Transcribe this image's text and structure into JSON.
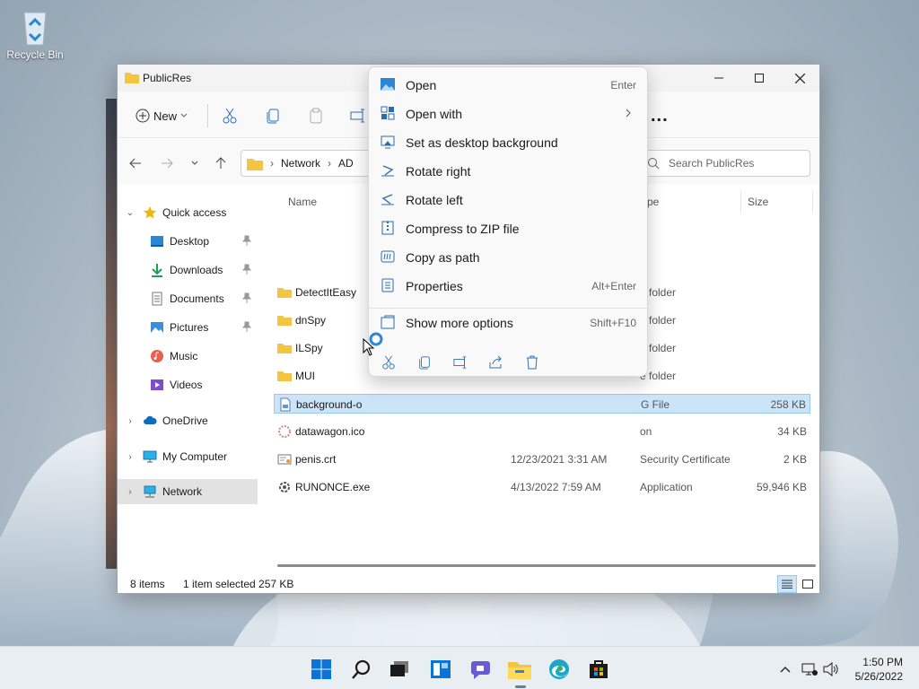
{
  "desktop": {
    "recycle_bin": "Recycle Bin"
  },
  "window": {
    "title": "PublicRes",
    "toolbar": {
      "new_label": "New",
      "more": "..."
    },
    "address": {
      "root": "Network",
      "segment": "AD"
    },
    "search_placeholder": "Search PublicRes"
  },
  "nav": {
    "quick_access": "Quick access",
    "items": [
      {
        "label": "Desktop"
      },
      {
        "label": "Downloads"
      },
      {
        "label": "Documents"
      },
      {
        "label": "Pictures"
      },
      {
        "label": "Music"
      },
      {
        "label": "Videos"
      }
    ],
    "onedrive": "OneDrive",
    "my_computer": "My Computer",
    "network": "Network"
  },
  "columns": {
    "name": "Name",
    "type": "pe",
    "size": "Size"
  },
  "files": [
    {
      "name": "DetectItEasy",
      "date": "",
      "type": "e folder",
      "size": ""
    },
    {
      "name": "dnSpy",
      "date": "",
      "type": "e folder",
      "size": ""
    },
    {
      "name": "ILSpy",
      "date": "",
      "type": "e folder",
      "size": ""
    },
    {
      "name": "MUI",
      "date": "",
      "type": "e folder",
      "size": ""
    },
    {
      "name": "background-o",
      "date": "",
      "type": "G File",
      "size": "258 KB"
    },
    {
      "name": "datawagon.ico",
      "date": "",
      "type": "on",
      "size": "34 KB"
    },
    {
      "name": "penis.crt",
      "date": "12/23/2021 3:31 AM",
      "type": "Security Certificate",
      "size": "2 KB"
    },
    {
      "name": "RUNONCE.exe",
      "date": "4/13/2022 7:59 AM",
      "type": "Application",
      "size": "59,946 KB"
    }
  ],
  "status": {
    "count": "8 items",
    "selection": "1 item selected  257 KB"
  },
  "context_menu": {
    "items": [
      {
        "label": "Open",
        "shortcut": "Enter"
      },
      {
        "label": "Open with",
        "shortcut": ""
      },
      {
        "label": "Set as desktop background",
        "shortcut": ""
      },
      {
        "label": "Rotate right",
        "shortcut": ""
      },
      {
        "label": "Rotate left",
        "shortcut": ""
      },
      {
        "label": "Compress to ZIP file",
        "shortcut": ""
      },
      {
        "label": "Copy as path",
        "shortcut": ""
      },
      {
        "label": "Properties",
        "shortcut": "Alt+Enter"
      }
    ],
    "more": {
      "label": "Show more options",
      "shortcut": "Shift+F10"
    }
  },
  "taskbar": {
    "time": "1:50 PM",
    "date": "5/26/2022"
  },
  "colors": {
    "accent": "#0067c0",
    "selection": "#cce4f7",
    "folder": "#f4c542"
  }
}
